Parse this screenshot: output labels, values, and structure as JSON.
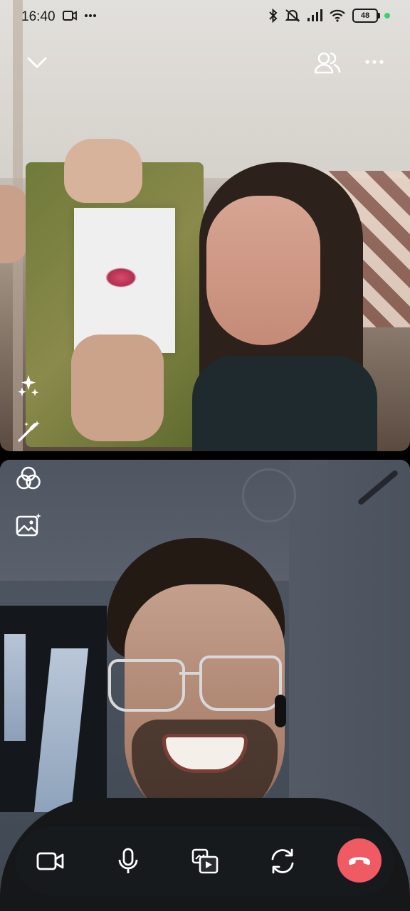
{
  "status_bar": {
    "time": "16:40",
    "left_icons": [
      "video-record-icon",
      "more-dots-icon"
    ],
    "right_icons": [
      "bluetooth-icon",
      "mute-icon",
      "signal-icon",
      "wifi-icon"
    ],
    "battery_level": "48",
    "active_indicator_color": "#3ed06e"
  },
  "top_controls": {
    "minimize": "chevron-down-icon",
    "participants": "participants-icon",
    "more": "more-options-icon"
  },
  "side_tools": [
    "sparkle-effects-icon",
    "magic-wand-icon",
    "filters-icon",
    "background-image-icon"
  ],
  "call_controls": {
    "buttons": [
      "camera-toggle",
      "microphone-toggle",
      "screen-share",
      "flip-camera",
      "end-call"
    ],
    "end_call_color": "#f05a63"
  }
}
